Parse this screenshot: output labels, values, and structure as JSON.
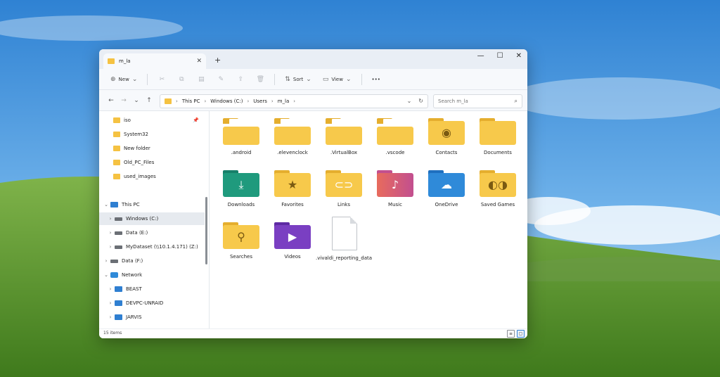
{
  "window": {
    "tab_title": "m_la",
    "new_tab_symbol": "+",
    "controls": {
      "minimize": "—",
      "maximize": "☐",
      "close": "✕"
    }
  },
  "toolbar": {
    "new_label": "New",
    "sort_label": "Sort",
    "view_label": "View",
    "more_label": "•••"
  },
  "address": {
    "segments": [
      "This PC",
      "Windows (C:)",
      "Users",
      "m_la"
    ]
  },
  "search": {
    "placeholder": "Search m_la"
  },
  "sidebar": {
    "pinned": [
      {
        "label": "iso"
      },
      {
        "label": "System32"
      },
      {
        "label": "New folder"
      },
      {
        "label": "Old_PC_Files"
      },
      {
        "label": "used_images"
      }
    ],
    "this_pc": "This PC",
    "drives": [
      {
        "label": "Windows (C:)"
      },
      {
        "label": "Data (E:)"
      },
      {
        "label": "MyDataset (\\\\10.1.4.171) (Z:)"
      },
      {
        "label": "Data (F:)"
      }
    ],
    "network": "Network",
    "network_items": [
      {
        "label": "BEAST"
      },
      {
        "label": "DEVPC-UNRAID"
      },
      {
        "label": "JARVIS"
      }
    ]
  },
  "items": [
    {
      "label": ".android",
      "type": "folder-paper",
      "color": "#f7c94b"
    },
    {
      "label": ".elevenclock",
      "type": "folder-paper",
      "color": "#f7c94b"
    },
    {
      "label": ".VirtualBox",
      "type": "folder-paper",
      "color": "#f7c94b"
    },
    {
      "label": ".vscode",
      "type": "folder-paper",
      "color": "#f7c94b"
    },
    {
      "label": "Contacts",
      "type": "folder-glyph",
      "color": "#f7c94b",
      "glyph": "contact-person-icon"
    },
    {
      "label": "Documents",
      "type": "folder-plain",
      "color": "#f7c94b"
    },
    {
      "label": "Downloads",
      "type": "folder-glyph",
      "color": "#1f9a7d",
      "glyph": "download-arrow-icon"
    },
    {
      "label": "Favorites",
      "type": "folder-glyph",
      "color": "#f7c94b",
      "glyph": "star-icon"
    },
    {
      "label": "Links",
      "type": "folder-glyph",
      "color": "#f7c94b",
      "glyph": "link-icon"
    },
    {
      "label": "Music",
      "type": "folder-glyph",
      "color": "#e86b5d",
      "glyph": "music-note-icon"
    },
    {
      "label": "OneDrive",
      "type": "folder-glyph",
      "color": "#2f8ad9",
      "glyph": "cloud-icon"
    },
    {
      "label": "Saved Games",
      "type": "folder-glyph",
      "color": "#f7c94b",
      "glyph": "gamepad-icon"
    },
    {
      "label": "Searches",
      "type": "folder-glyph",
      "color": "#f7c94b",
      "glyph": "magnifier-icon"
    },
    {
      "label": "Videos",
      "type": "folder-glyph",
      "color": "#7a3fc2",
      "glyph": "play-icon"
    },
    {
      "label": ".vivaldi_reporting_data",
      "type": "file"
    }
  ],
  "status": {
    "item_count": "15 items"
  }
}
